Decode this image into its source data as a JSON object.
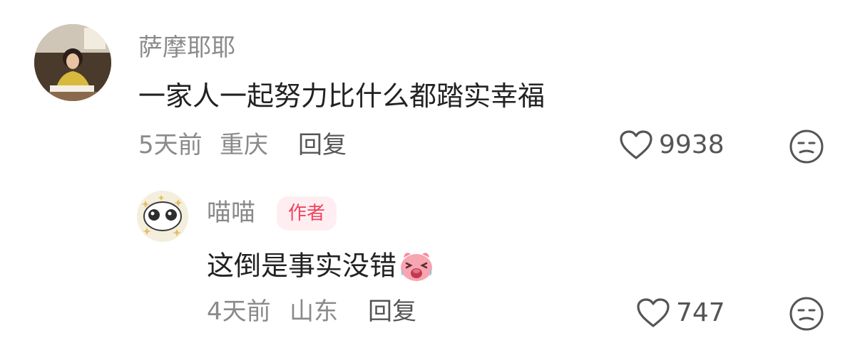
{
  "comments": [
    {
      "username": "萨摩耶耶",
      "content": "一家人一起努力比什么都踏实幸福",
      "time": "5天前",
      "location": "重庆",
      "reply_label": "回复",
      "likes": "9938",
      "icons": {
        "like": "heart-outline-icon",
        "dislike": "meh-face-icon"
      }
    },
    {
      "username": "喵喵",
      "badge": "作者",
      "content": "这倒是事实没错",
      "emoji": "crying-laughing-pig-emoji",
      "time": "4天前",
      "location": "山东",
      "reply_label": "回复",
      "likes": "747",
      "icons": {
        "like": "heart-outline-icon",
        "dislike": "meh-face-icon"
      }
    }
  ],
  "colors": {
    "username": "#8a8a8a",
    "content": "#222222",
    "badge_bg": "#ffeef1",
    "badge_text": "#f0445d",
    "icon": "#555555"
  }
}
